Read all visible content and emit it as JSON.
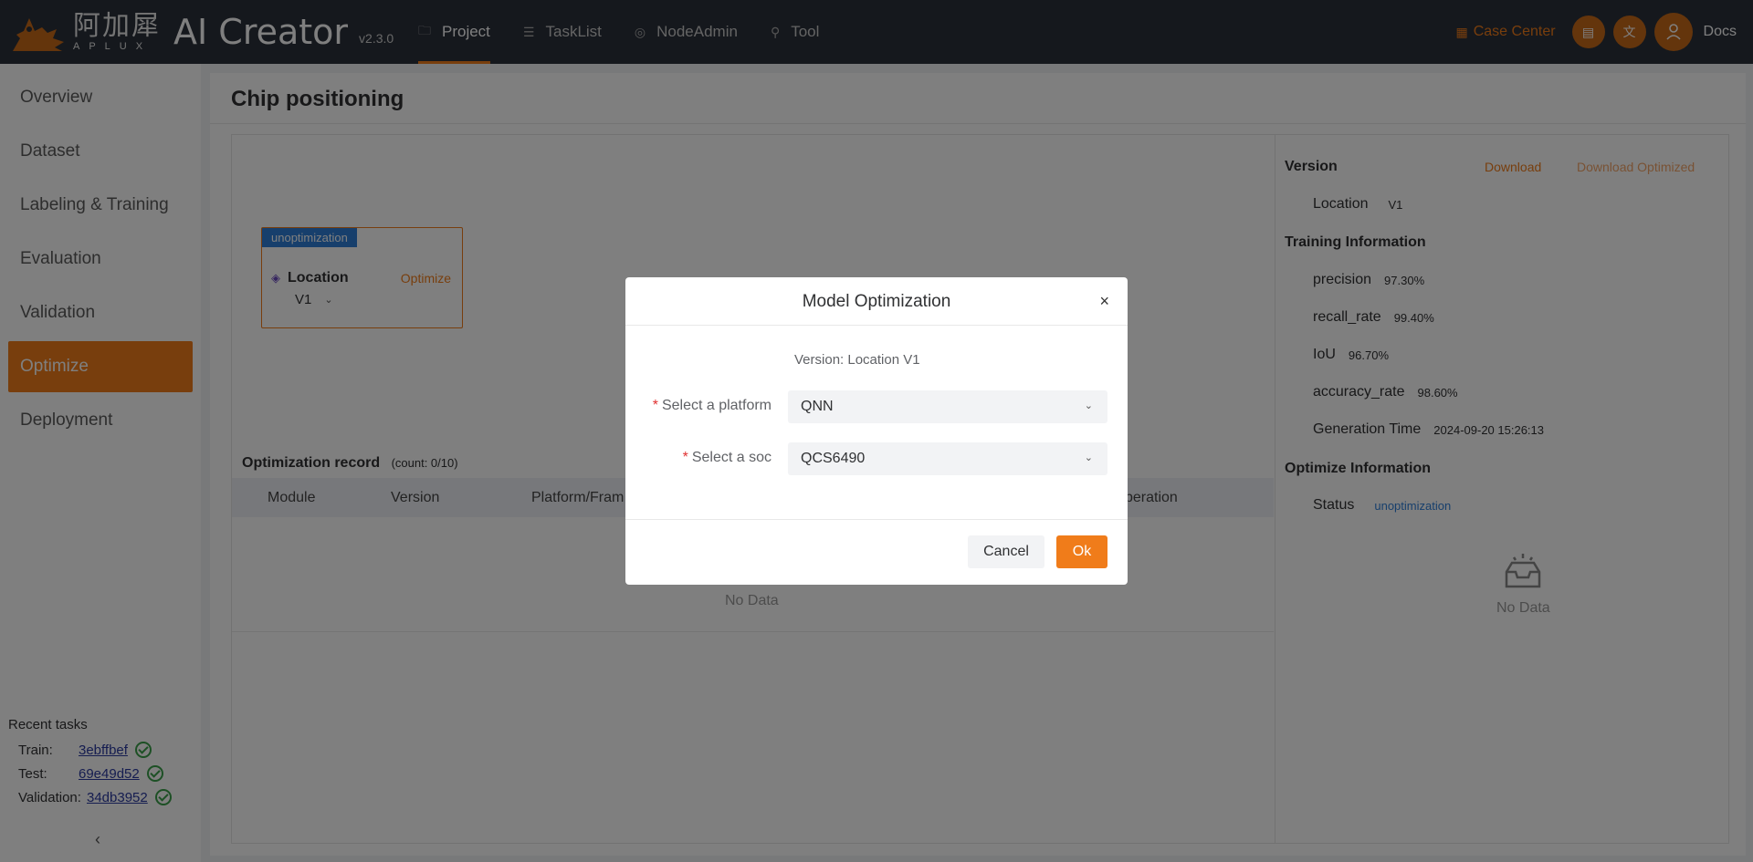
{
  "header": {
    "logo_cn": "阿加犀",
    "logo_en": "APLUX",
    "app_title": "AI Creator",
    "version": "v2.3.0",
    "nav": [
      {
        "label": "Project",
        "icon": "folder-icon",
        "active": true
      },
      {
        "label": "TaskList",
        "icon": "list-icon",
        "active": false
      },
      {
        "label": "NodeAdmin",
        "icon": "node-icon",
        "active": false
      },
      {
        "label": "Tool",
        "icon": "wrench-icon",
        "active": false
      }
    ],
    "case_center": "Case Center",
    "docs": "Docs",
    "accent": "#f07c1a"
  },
  "sidebar": {
    "items": [
      {
        "label": "Overview"
      },
      {
        "label": "Dataset"
      },
      {
        "label": "Labeling & Training"
      },
      {
        "label": "Evaluation"
      },
      {
        "label": "Validation"
      },
      {
        "label": "Optimize",
        "active": true
      },
      {
        "label": "Deployment"
      }
    ],
    "recent_title": "Recent tasks",
    "recent": [
      {
        "key": "Train:",
        "id": "3ebffbef"
      },
      {
        "key": "Test:",
        "id": "69e49d52"
      },
      {
        "key": "Validation:",
        "id": "34db3952"
      }
    ]
  },
  "main": {
    "title": "Chip positioning",
    "node": {
      "tag": "unoptimization",
      "name": "Location",
      "action": "Optimize",
      "version": "V1"
    },
    "record": {
      "title": "Optimization record",
      "count": "(count:  0/10)",
      "columns": [
        "Module",
        "Version",
        "Platform/Fram",
        "peration"
      ],
      "empty": "No Data"
    },
    "info": {
      "version_heading": "Version",
      "download": "Download",
      "download_optimized": "Download Optimized",
      "location_label": "Location",
      "location_value": "V1",
      "training_heading": "Training Information",
      "metrics": [
        {
          "key": "precision",
          "value": "97.30%"
        },
        {
          "key": "recall_rate",
          "value": "99.40%"
        },
        {
          "key": "IoU",
          "value": "96.70%"
        },
        {
          "key": "accuracy_rate",
          "value": "98.60%"
        },
        {
          "key": "Generation Time",
          "value": "2024-09-20 15:26:13"
        }
      ],
      "optimize_heading": "Optimize Information",
      "status_label": "Status",
      "status_value": "unoptimization",
      "empty": "No Data"
    }
  },
  "dialog": {
    "title": "Model Optimization",
    "close": "×",
    "version_line": "Version:  Location V1",
    "platform_label": "Select a platform",
    "platform_value": "QNN",
    "soc_label": "Select a soc",
    "soc_value": "QCS6490",
    "cancel": "Cancel",
    "ok": "Ok"
  }
}
